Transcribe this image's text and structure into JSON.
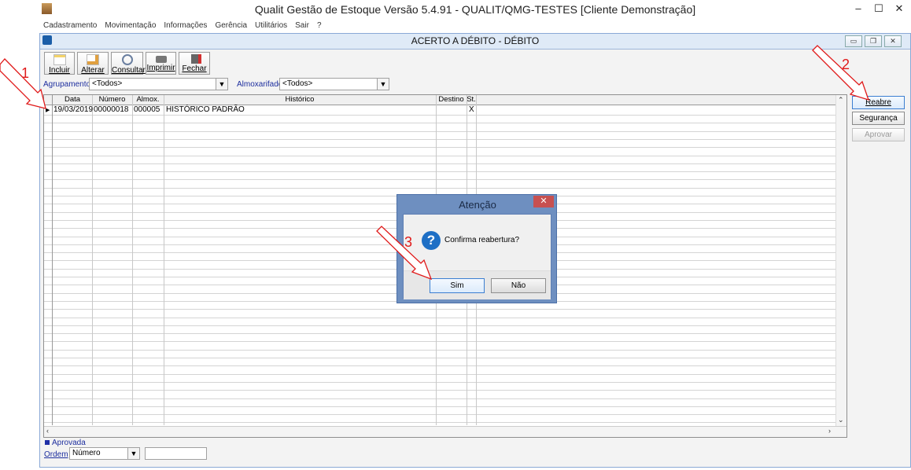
{
  "app": {
    "title": "Qualit Gestão de Estoque Versão 5.4.91 - QUALIT/QMG-TESTES [Cliente Demonstração]"
  },
  "window_controls": {
    "minimize": "–",
    "maximize": "☐",
    "close": "✕"
  },
  "menu": [
    "Cadastramento",
    "Movimentação",
    "Informações",
    "Gerência",
    "Utilitários",
    "Sair",
    "?"
  ],
  "inner_window": {
    "title": "ACERTO A DÉBITO - DÉBITO"
  },
  "toolbar": {
    "incluir": "Incluir",
    "alterar": "Alterar",
    "consultar": "Consultar",
    "imprimir": "Imprimir",
    "fechar": "Fechar"
  },
  "filters": {
    "agrupamento_label": "Agrupamento",
    "agrupamento_value": "<Todos>",
    "almoxarifado_label": "Almoxarifado",
    "almoxarifado_value": "<Todos>"
  },
  "grid": {
    "columns": [
      "Data",
      "Número",
      "Almox.",
      "Histórico",
      "Destino",
      "St."
    ],
    "rows": [
      {
        "data": "19/03/2019",
        "numero": "00000018",
        "almox": "000005",
        "historico": "HISTÓRICO PADRÃO",
        "destino": "",
        "st": "X"
      }
    ]
  },
  "side_buttons": {
    "reabre": "Reabre",
    "seguranca": "Segurança",
    "aprovar": "Aprovar"
  },
  "legend": {
    "aprovada": "Aprovada"
  },
  "ordem": {
    "label": "Ordem",
    "value": "Número",
    "search_value": ""
  },
  "dialog": {
    "title": "Atenção",
    "close": "✕",
    "message": "Confirma reabertura?",
    "sim": "Sim",
    "nao": "Não",
    "icon": "?"
  },
  "annotations": {
    "a1": "1",
    "a2": "2",
    "a3": "3"
  },
  "colors": {
    "annotation": "#e01a1a",
    "dialog_frame": "#6e8fc0",
    "label_blue": "#1d2e9e"
  }
}
